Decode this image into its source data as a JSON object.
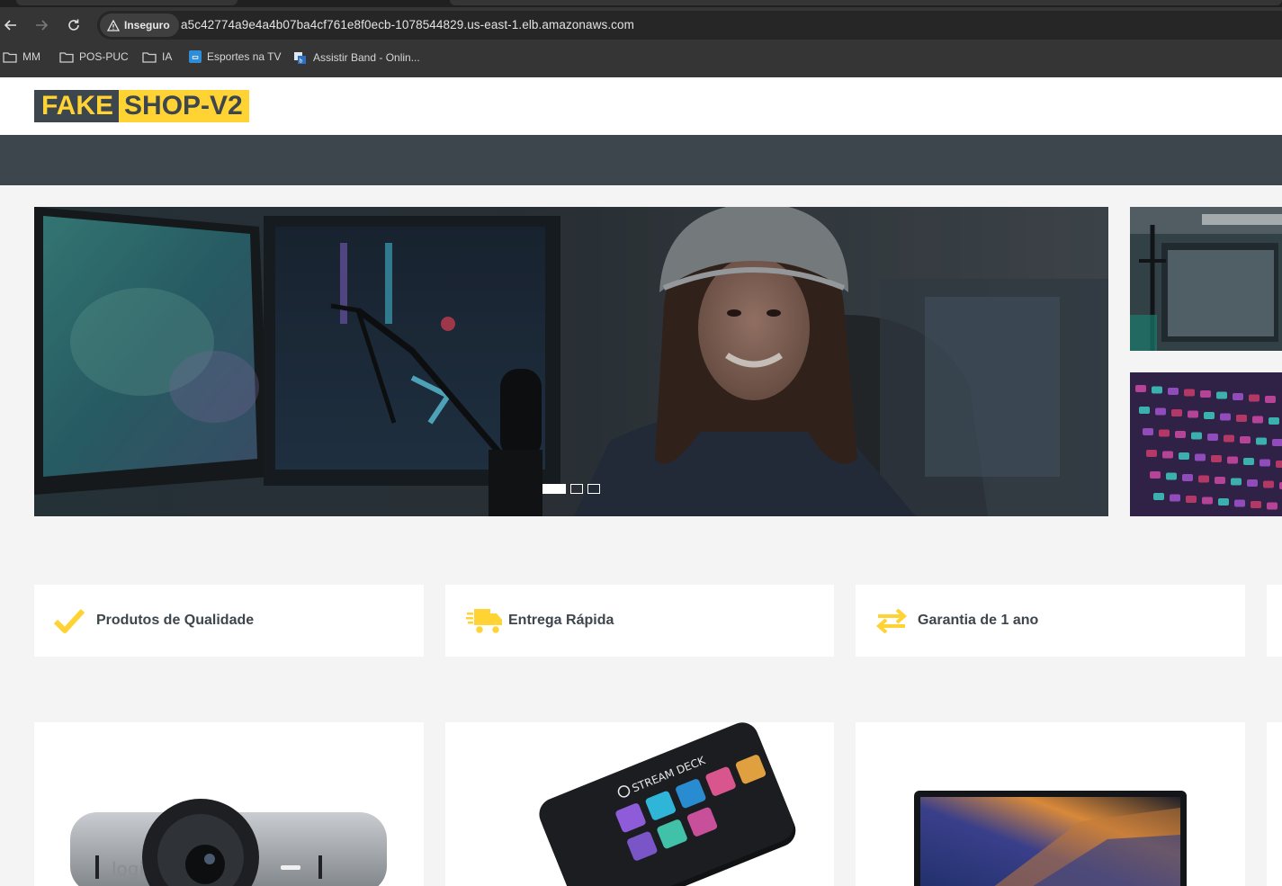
{
  "browser": {
    "security_label": "Inseguro",
    "url": "a5c42774a9e4a4b07ba4cf761e8f0ecb-1078544829.us-east-1.elb.amazonaws.com",
    "bookmarks": [
      {
        "label": "MM",
        "icon": "folder-icon"
      },
      {
        "label": "POS-PUC",
        "icon": "folder-icon"
      },
      {
        "label": "IA",
        "icon": "folder-icon"
      },
      {
        "label": "Esportes na TV",
        "icon": "tv-favicon"
      },
      {
        "label": "Assistir Band - Onlin...",
        "icon": "band-favicon"
      }
    ]
  },
  "site": {
    "logo_part1": "FAKE",
    "logo_part2": "SHOP-V2"
  },
  "carousel": {
    "slide_count": 3,
    "active_index": 0
  },
  "features": [
    {
      "label": "Produtos de Qualidade",
      "icon": "check-icon"
    },
    {
      "label": "Entrega Rápida",
      "icon": "shipping-truck-icon"
    },
    {
      "label": "Garantia de 1 ano",
      "icon": "exchange-arrows-icon"
    }
  ],
  "colors": {
    "primary_yellow": "#FFD333",
    "dark_slate": "#3D464D",
    "background": "#F4F4F4"
  }
}
